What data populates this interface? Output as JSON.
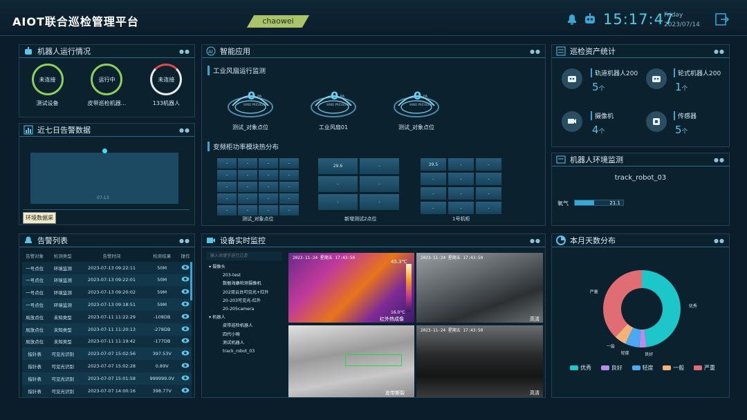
{
  "header": {
    "title": "AIOT联合巡检管理平台",
    "user": "chaowei",
    "time": "15:17:47",
    "weekday": "Friday",
    "date": "2023/07/14"
  },
  "robot_status": {
    "title": "机器人运行情况",
    "items": [
      {
        "status": "未连接",
        "name": "测试设备",
        "color": "#8ccf5a"
      },
      {
        "status": "运行中",
        "name": "皮带巡检机器...",
        "color": "#8ccf5a"
      },
      {
        "status": "未连接",
        "name": "133机器人",
        "color": "#e8e8e8"
      }
    ]
  },
  "alarm7": {
    "title": "近七日告警数据",
    "x_label": "07-13",
    "tooltip": "环境数据采"
  },
  "alarm_list": {
    "title": "告警列表",
    "columns": [
      "告警对象",
      "检测类型",
      "告警时间",
      "检测结果",
      "操作"
    ],
    "rows": [
      [
        "一号点位",
        "环境监测",
        "2023-07-13 09:22:11",
        "50M"
      ],
      [
        "一号点位",
        "环境监测",
        "2023-07-13 09:22:01",
        "50M"
      ],
      [
        "一号点位",
        "环境监测",
        "2023-07-13 09:20:02",
        "59M"
      ],
      [
        "一号点位",
        "环境监测",
        "2023-07-13 09:18:51",
        "59M"
      ],
      [
        "局放点位",
        "未知类型",
        "2023-07-11 11:22:29",
        "-108DB"
      ],
      [
        "局放点位",
        "未知类型",
        "2023-07-11 11:20:13",
        "-278DB"
      ],
      [
        "局放点位",
        "未知类型",
        "2023-07-11 11:19:42",
        "-177DB"
      ],
      [
        "指针表",
        "可见光识别",
        "2023-07-07 15:02:56",
        "397.53V"
      ],
      [
        "指针表",
        "可见光识别",
        "2023-07-07 15:02:28",
        "0.89V"
      ],
      [
        "指针表",
        "可见光识别",
        "2023-07-07 15:01:58",
        "999999.0V"
      ],
      [
        "指针表",
        "可见光识别",
        "2023-07-07 14:00:16",
        "398.77V"
      ]
    ]
  },
  "smart_app": {
    "title": "智能应用",
    "fan_title": "工业风扇运行监测",
    "unit": "PA",
    "unit_sub": "WIND PRESSURE",
    "fans": [
      {
        "value": "0",
        "name": "测试_对象点位"
      },
      {
        "value": "0",
        "name": "工业风扇01"
      },
      {
        "value": "0",
        "name": "测试_对象点位"
      }
    ],
    "heat_title": "变频柜功率模块热分布",
    "heat": [
      {
        "name": "测试_对象点位",
        "cells": [
          "-",
          "-",
          "-",
          "-",
          "-",
          "-",
          "-",
          "-",
          "-",
          "-",
          "-",
          "-",
          "-",
          "-",
          "-",
          "-",
          "-",
          "-",
          "-",
          "-"
        ]
      },
      {
        "name": "新增测试2点位",
        "cells": [
          "29.6",
          "-",
          "-",
          "-",
          "-",
          "-"
        ]
      },
      {
        "name": "1号机柜",
        "cells": [
          "29.5",
          "-",
          "-",
          "-",
          "-",
          "-",
          "-",
          "-",
          "-",
          "-",
          "-",
          "-"
        ]
      }
    ]
  },
  "monitor": {
    "title": "设备实时监控",
    "search_placeholder": "输入关键字进行过滤",
    "tree": [
      {
        "label": "摄像头",
        "level": 0
      },
      {
        "label": "203-test",
        "level": 1
      },
      {
        "label": "数据海康检测摄像机",
        "level": 1
      },
      {
        "label": "202双云台可见光+红外",
        "level": 1
      },
      {
        "label": "20-203可见光-红外",
        "level": 1
      },
      {
        "label": "20-205camera",
        "level": 1
      },
      {
        "label": "机器人",
        "level": 0
      },
      {
        "label": "皮带巡检机器人",
        "level": 1
      },
      {
        "label": "四代小嗨",
        "level": 1
      },
      {
        "label": "测试机器人",
        "level": 1
      },
      {
        "label": "track_robot_03",
        "level": 1
      }
    ],
    "videos": [
      {
        "stamp": "2023-11-24 星期五 17:43:50",
        "corner": "45.3℃",
        "bottom": "16.0°C",
        "label": "红外热成像"
      },
      {
        "stamp": "2023-11-24 星期五 17:43:50",
        "corner": "",
        "bottom": "",
        "label": "高清"
      },
      {
        "stamp": "",
        "corner": "",
        "bottom": "",
        "label": "皮带撕裂"
      },
      {
        "stamp": "2023-11-24 星期五 17:43:50",
        "corner": "",
        "bottom": "",
        "label": "高清"
      }
    ]
  },
  "assets": {
    "title": "巡检资产统计",
    "items": [
      {
        "name": "轨道机器人200",
        "count": "5",
        "unit": "个"
      },
      {
        "name": "轮式机器人200",
        "count": "1",
        "unit": "个"
      },
      {
        "name": "摄像机",
        "count": "4",
        "unit": "个"
      },
      {
        "name": "传感器",
        "count": "5",
        "unit": "个"
      }
    ]
  },
  "env": {
    "title": "机器人环境监测",
    "robot": "track_robot_03",
    "label": "氧气",
    "value": "21.1",
    "fraction": 0.4
  },
  "days": {
    "title": "本月天数分布"
  },
  "chart_data": {
    "type": "pie",
    "categories": [
      "优秀",
      "良好",
      "轻度",
      "一般",
      "严重"
    ],
    "values": [
      48,
      3,
      6,
      5,
      38
    ],
    "colors": [
      "#1cc6c9",
      "#b48ee8",
      "#4aa9f0",
      "#f2b27a",
      "#e06c74"
    ],
    "legend": "bottom"
  }
}
